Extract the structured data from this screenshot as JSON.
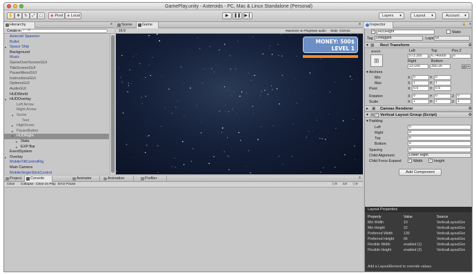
{
  "window": {
    "title": "GamePlay.unity - Asteroids - PC, Mac & Linux Standalone (Personal)"
  },
  "toolbar": {
    "pivot_label": "Pivot",
    "local_label": "Local",
    "layers_label": "Layers",
    "layout_label": "Layout",
    "account_label": "Account"
  },
  "hierarchy": {
    "tab_label": "Hierarchy",
    "create_label": "Create",
    "search_placeholder": "All",
    "items": [
      {
        "label": "Asteroid Spawner",
        "color": "#1f3fa8"
      },
      {
        "label": "Bullet",
        "color": "#1f3fa8"
      },
      {
        "label": "Space Ship",
        "color": "#1f3fa8"
      },
      {
        "label": "Background",
        "color": "#111111"
      },
      {
        "label": "Music",
        "color": "#1f3fa8"
      },
      {
        "label": "GameOverScreenGUI",
        "color": "#444444"
      },
      {
        "label": "TitleScreenGUI",
        "color": "#444444"
      },
      {
        "label": "PauseMenuGUI",
        "color": "#444444"
      },
      {
        "label": "InstructionsGUI",
        "color": "#444444"
      },
      {
        "label": "OptionsGUI",
        "color": "#444444"
      },
      {
        "label": "AudioGUI",
        "color": "#444444"
      },
      {
        "label": "HUDWorld",
        "color": "#111111"
      },
      {
        "label": "HUDOverlay",
        "color": "#111111"
      },
      {
        "label": "Left Arrow",
        "color": "#555555"
      },
      {
        "label": "Right Arrow",
        "color": "#555555"
      },
      {
        "label": "Score",
        "color": "#555555"
      },
      {
        "label": "Text",
        "color": "#555555"
      },
      {
        "label": "HighScore",
        "color": "#555555"
      },
      {
        "label": "PauseButton",
        "color": "#555555"
      },
      {
        "label": "HUDRight",
        "color": "#ffffff"
      },
      {
        "label": "Stats",
        "color": "#111111"
      },
      {
        "label": "EXP Bar",
        "color": "#111111"
      },
      {
        "label": "EventSystem",
        "color": "#111111"
      },
      {
        "label": "Overlay",
        "color": "#111111"
      },
      {
        "label": "MobileTiltControlRig",
        "color": "#1f3fa8"
      },
      {
        "label": "Main Camera",
        "color": "#111111"
      },
      {
        "label": "MobileSingleStickControl",
        "color": "#1f3fa8"
      }
    ]
  },
  "view_tabs": {
    "scene": "Scene",
    "game": "Game"
  },
  "game_bar": {
    "aspect": "16:9",
    "maximize": "Maximize on Play",
    "mute": "Mute audio",
    "stats": "Stats",
    "gizmos": "Gizmos"
  },
  "hud": {
    "money": "MONEY: 500$",
    "level": "LEVEL 1",
    "accent": "#f28c28",
    "panel_color": "#6b8fc4"
  },
  "bottom_tabs": {
    "project": "Project",
    "console": "Console",
    "animator": "Animator",
    "animation": "Animation",
    "profiler": "Profiler"
  },
  "console": {
    "clear": "Clear",
    "collapse": "Collapse",
    "clear_on_play": "Clear on Play",
    "error_pause": "Error Pause",
    "count_info": "0",
    "count_warn": "0",
    "count_error": "0"
  },
  "inspector": {
    "tab_label": "Inspector",
    "object_name": "HUDRight",
    "static_label": "Static",
    "tag_label": "Tag",
    "tag_value": "Untagged",
    "layer_label": "Layer",
    "layer_value": "UI",
    "rect_transform": {
      "title": "Rect Transform",
      "stretch_label": "stretch",
      "left_label": "Left",
      "top_label": "Top",
      "posz_label": "Pos Z",
      "left": "573.355",
      "top": "6.740005",
      "posz": "0",
      "right_label": "Right",
      "bottom_label": "Bottom",
      "right": "13.155",
      "bottom": "350.26",
      "raw_label": "R"
    },
    "anchors": {
      "title": "Anchors",
      "min_label": "Min",
      "min_x": "0",
      "min_y": "0",
      "max_label": "Max",
      "max_x": "1",
      "max_y": "1",
      "pivot_label": "Pivot",
      "pivot_x": "0.5",
      "pivot_y": "0.5"
    },
    "rotation": {
      "label": "Rotation",
      "x": "0",
      "y": "0",
      "z": "0"
    },
    "scale": {
      "label": "Scale",
      "x": "1",
      "y": "1",
      "z": "1"
    },
    "axis_x": "X",
    "axis_y": "Y",
    "axis_z": "Z",
    "canvas_renderer": "Canvas Renderer",
    "vlg": {
      "title": "Vertical Layout Group (Script)",
      "padding_label": "Padding",
      "left_label": "Left",
      "left": "0",
      "right_label": "Right",
      "right": "0",
      "top_label": "Top",
      "top": "0",
      "bottom_label": "Bottom",
      "bottom": "0",
      "spacing_label": "Spacing",
      "spacing": "0",
      "child_alignment_label": "Child Alignment",
      "child_alignment": "Lower Right",
      "child_force_label": "Child Force Expand",
      "width_label": "Width",
      "height_label": "Height"
    },
    "add_component": "Add Component"
  },
  "layout_properties": {
    "title": "Layout Properties",
    "headers": [
      "Property",
      "Value",
      "Source"
    ],
    "rows": [
      [
        "Min Width",
        "10",
        "VerticalLayoutGro"
      ],
      [
        "Min Height",
        "22",
        "VerticalLayoutGro"
      ],
      [
        "Preferred Width",
        "130",
        "VerticalLayoutGro"
      ],
      [
        "Preferred Height",
        "66",
        "VerticalLayoutGro"
      ],
      [
        "Flexible Width",
        "enabled (1)",
        "VerticalLayoutGro"
      ],
      [
        "Flexible Height",
        "enabled (2)",
        "VerticalLayoutGro"
      ]
    ],
    "hint": "Add a LayoutElement to override values."
  }
}
